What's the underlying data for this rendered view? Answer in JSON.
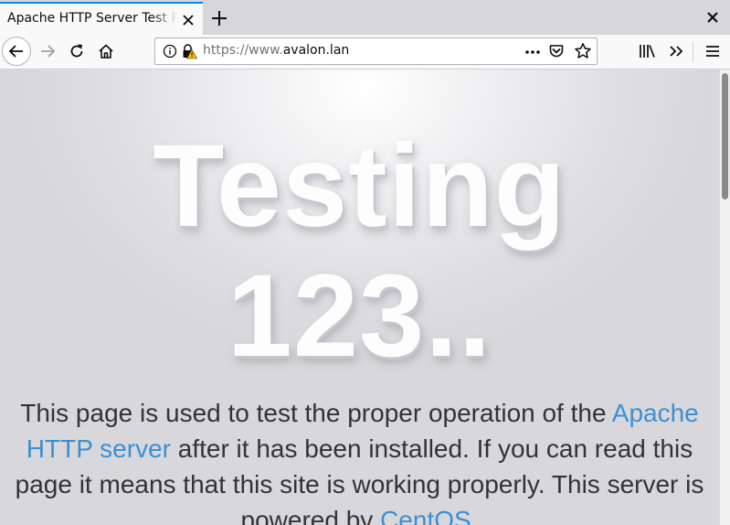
{
  "tab": {
    "title": "Apache HTTP Server Test Page powered by CentOS"
  },
  "urlbar": {
    "scheme_prefix": "https://www.",
    "domain": "avalon.lan"
  },
  "page": {
    "heading_line1": "Testing",
    "heading_line2": "123..",
    "desc_1": "This page is used to test the proper operation of the ",
    "link_apache": "Apache HTTP server",
    "desc_2": " after it has been installed. If you can read this page it means that this site is working properly. This server is powered by ",
    "link_centos": "CentOS",
    "desc_3": "."
  },
  "colors": {
    "accent": "#0a84ff",
    "link": "#3b8fd2",
    "warning": "#ffbf00"
  },
  "icons": [
    "close-icon",
    "plus-icon",
    "back-arrow-icon",
    "forward-arrow-icon",
    "reload-icon",
    "home-icon",
    "info-icon",
    "lock-warning-icon",
    "more-icon",
    "pocket-icon",
    "star-icon",
    "library-icon",
    "overflow-chevron-icon",
    "hamburger-menu-icon"
  ]
}
